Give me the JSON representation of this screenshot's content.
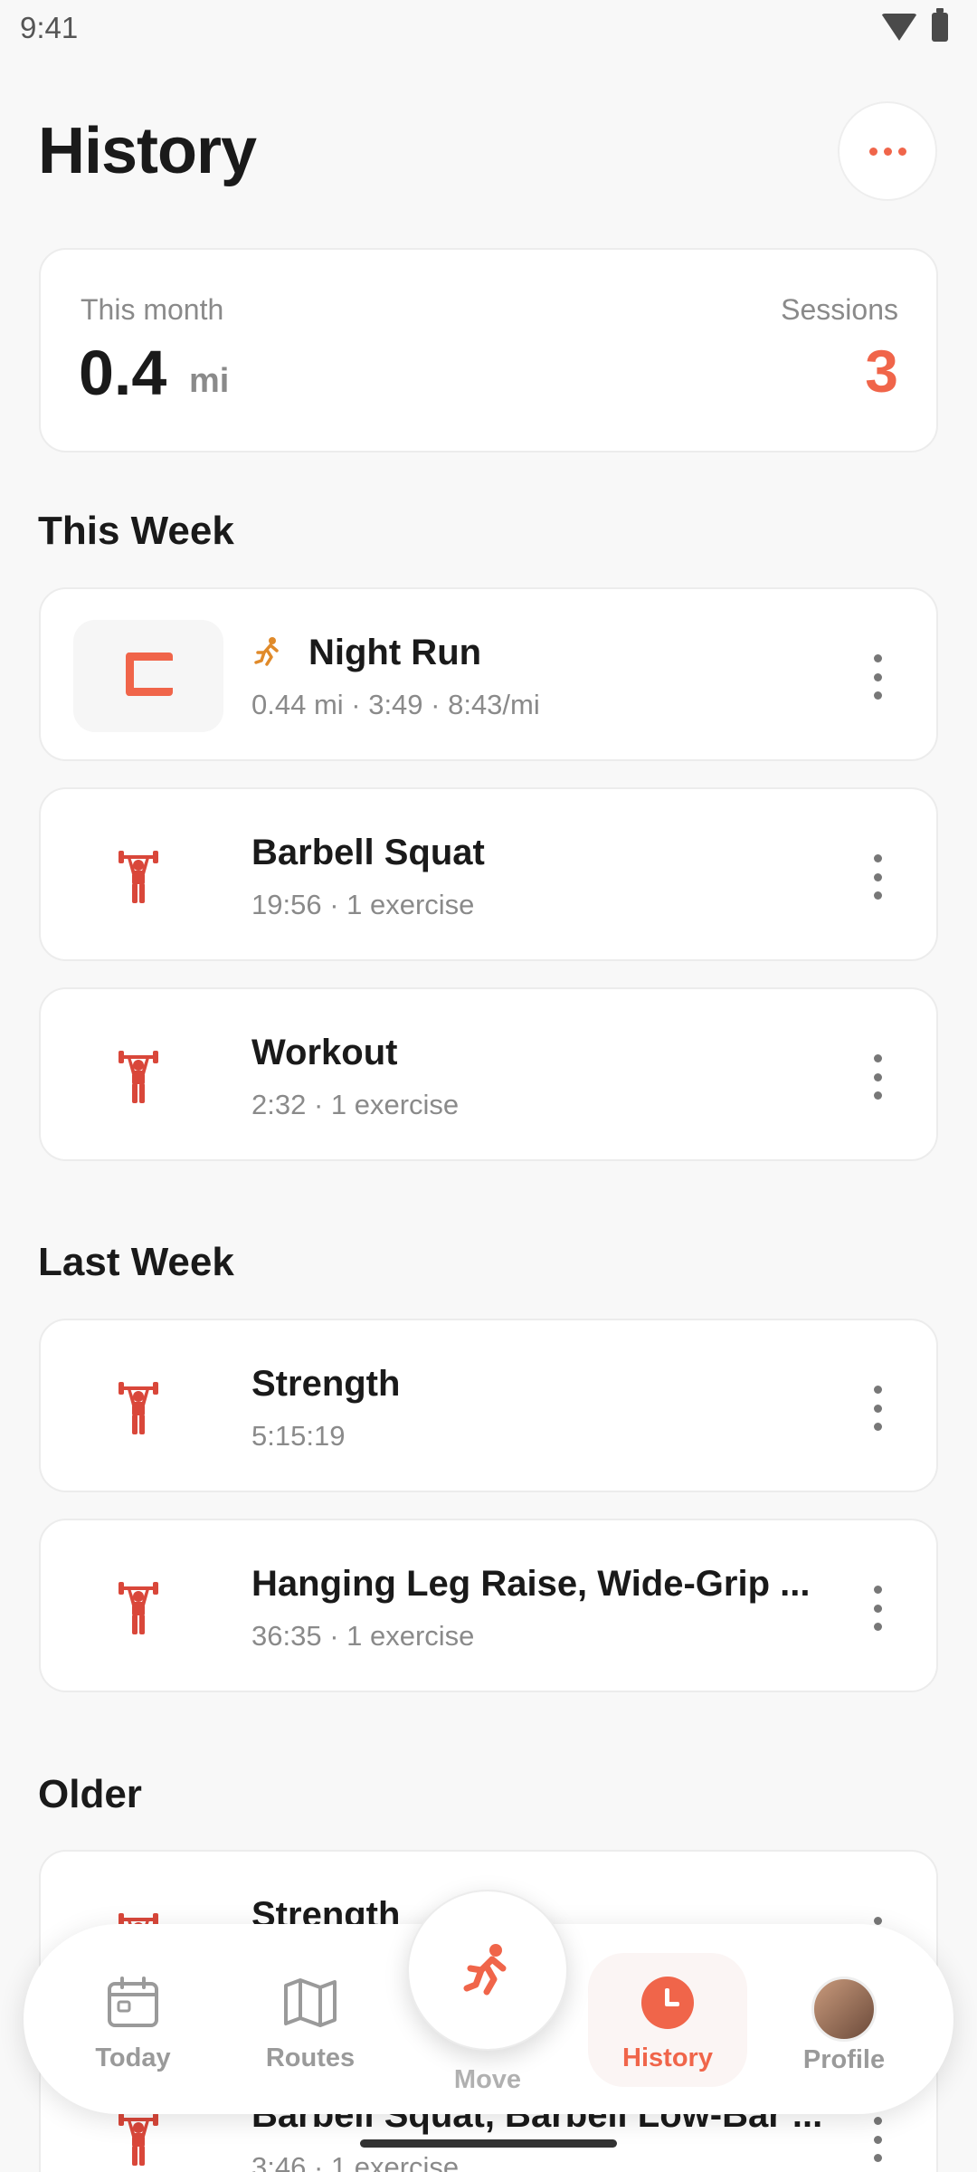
{
  "status_bar": {
    "time": "9:41"
  },
  "header": {
    "title": "History"
  },
  "summary": {
    "month_label": "This month",
    "distance": "0.4",
    "unit": "mi",
    "sessions_label": "Sessions",
    "sessions": "3"
  },
  "sections": {
    "this_week": "This Week",
    "last_week": "Last Week",
    "older": "Older"
  },
  "activities": [
    {
      "title": "Night Run",
      "subtitle": "0.44 mi · 3:49 · 8:43/mi",
      "icon": "route-thumbnail",
      "emoji": "running-icon"
    },
    {
      "title": "Barbell Squat",
      "subtitle": "19:56 · 1 exercise",
      "icon": "weightlifter-icon"
    },
    {
      "title": "Workout",
      "subtitle": "2:32 · 1 exercise",
      "icon": "weightlifter-icon"
    },
    {
      "title": "Strength",
      "subtitle": "5:15:19",
      "icon": "weightlifter-icon"
    },
    {
      "title": "Hanging Leg Raise, Wide-Grip ...",
      "subtitle": "36:35 · 1 exercise",
      "icon": "weightlifter-icon"
    },
    {
      "title": "Strength",
      "subtitle": "",
      "icon": "weightlifter-icon"
    },
    {
      "title": "Barbell Squat, Barbell Low-Bar ...",
      "subtitle": "3:46 · 1 exercise",
      "icon": "weightlifter-icon"
    }
  ],
  "nav": {
    "today": "Today",
    "routes": "Routes",
    "move": "Move",
    "history": "History",
    "profile": "Profile",
    "active": "history"
  },
  "colors": {
    "accent": "#f0654a",
    "icon_red": "#d9473a",
    "muted": "#8a8a8a"
  }
}
